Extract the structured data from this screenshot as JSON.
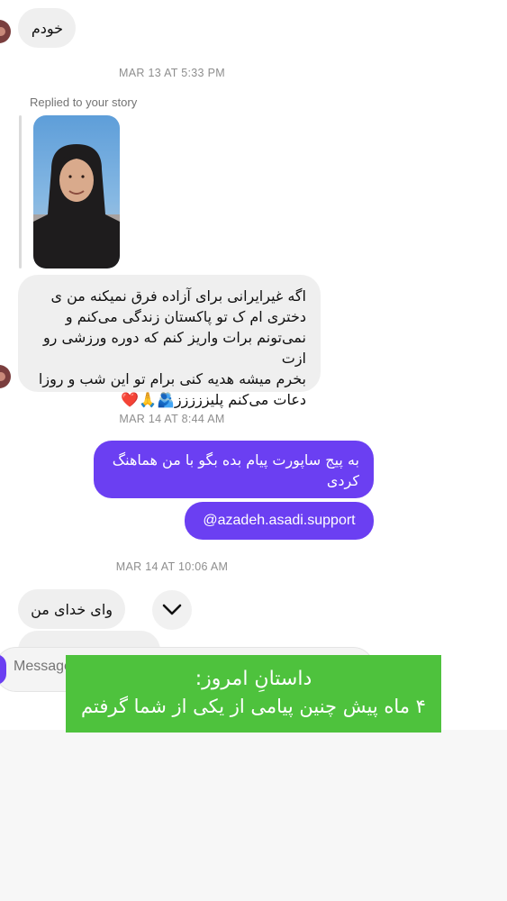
{
  "messages": {
    "msg1_text": "خودم",
    "timestamp1": "MAR 13 AT 5:33 PM",
    "reply_label": "Replied to your story",
    "msg2_lines": [
      "اگه غیرایرانی برای آزاده فرق نمیکنه من ی",
      "دختری ام ک تو پاکستان زندگی می‌کنم و",
      "نمی‌تونم برات واریز کنم که دوره ورزشی رو ازت",
      "بخرم میشه هدیه کنی برام تو این شب و روزا",
      "دعات می‌کنم پلیززززز🫂🙏❤️"
    ],
    "timestamp2": "MAR 14 AT 8:44 AM",
    "out1_lines": [
      "به پیج ساپورت پیام بده بگو با من هماهنگ",
      "کردی"
    ],
    "out2_text": "@azadeh.asadi.support",
    "timestamp3": "MAR 14 AT 10:06 AM",
    "msg3_text": "وای خدای من"
  },
  "composer": {
    "placeholder": "Message"
  },
  "overlay": {
    "line1": "داستانِ امروز:",
    "line2": "۴ ماه پیش چنین پیامی از یکی از شما گرفتم"
  },
  "colors": {
    "outgoing_bubble": "#6b3ff2",
    "incoming_bubble": "#efefef",
    "banner": "#4ec23d"
  },
  "icons": {
    "scroll_down": "chevron-down-icon"
  }
}
